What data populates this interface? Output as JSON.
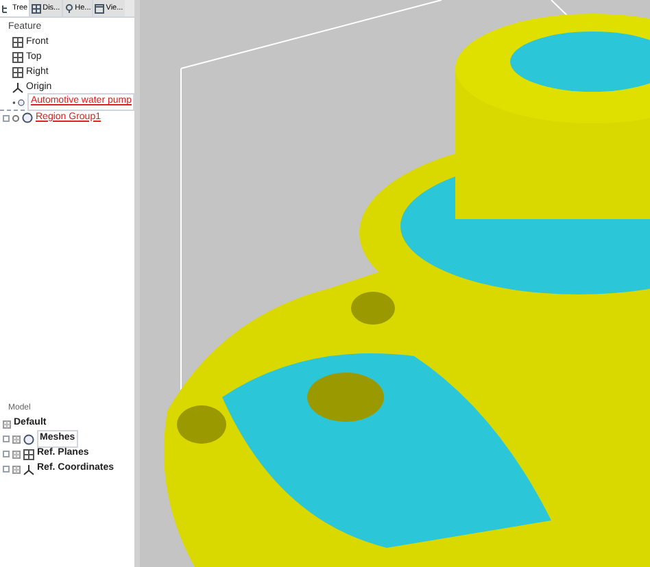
{
  "tabs": [
    {
      "label": "Tree",
      "selected": true
    },
    {
      "label": "Dis...",
      "selected": false
    },
    {
      "label": "He...",
      "selected": false
    },
    {
      "label": "Vie...",
      "selected": false
    }
  ],
  "feature_panel": {
    "title": "Feature",
    "items": [
      {
        "label": "Front",
        "kind": "plane",
        "flagged": false,
        "expandable": false,
        "selected": false
      },
      {
        "label": "Top",
        "kind": "plane",
        "flagged": false,
        "expandable": false,
        "selected": false
      },
      {
        "label": "Right",
        "kind": "plane",
        "flagged": false,
        "expandable": false,
        "selected": false
      },
      {
        "label": "Origin",
        "kind": "axes",
        "flagged": false,
        "expandable": false,
        "selected": false
      },
      {
        "label": "Automotive water pump",
        "kind": "mesh",
        "flagged": true,
        "expandable": false,
        "selected": true
      },
      {
        "label": "Region Group1",
        "kind": "mesh",
        "flagged": true,
        "expandable": true,
        "selected": false
      }
    ]
  },
  "model_panel": {
    "title": "Model",
    "items": [
      {
        "label": "Default",
        "kind": "none",
        "expandable": false,
        "selected": false
      },
      {
        "label": "Meshes",
        "kind": "mesh",
        "expandable": true,
        "selected": true
      },
      {
        "label": "Ref. Planes",
        "kind": "plane",
        "expandable": true,
        "selected": false
      },
      {
        "label": "Ref. Coordinates",
        "kind": "axes",
        "expandable": true,
        "selected": false
      }
    ]
  }
}
